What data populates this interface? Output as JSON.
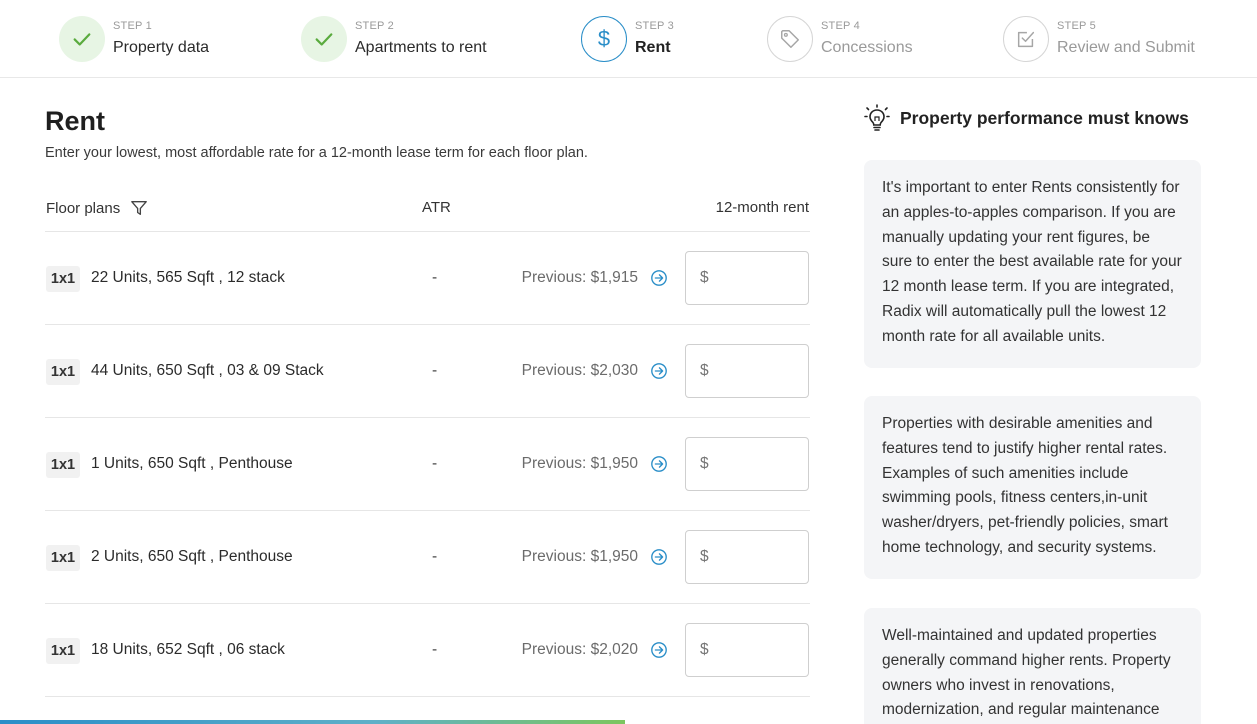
{
  "stepper": {
    "steps": [
      {
        "num": "STEP 1",
        "label": "Property data",
        "state": "done"
      },
      {
        "num": "STEP 2",
        "label": "Apartments to rent",
        "state": "done"
      },
      {
        "num": "STEP 3",
        "label": "Rent",
        "state": "active"
      },
      {
        "num": "STEP 4",
        "label": "Concessions",
        "state": "todo"
      },
      {
        "num": "STEP 5",
        "label": "Review and Submit",
        "state": "todo"
      }
    ]
  },
  "main": {
    "title": "Rent",
    "subtitle": "Enter your lowest, most affordable rate for a 12-month lease term for each floor plan.",
    "table": {
      "headers": {
        "floor_plans": "Floor plans",
        "atr": "ATR",
        "rent": "12-month rent"
      },
      "rows": [
        {
          "type": "1x1",
          "desc": "22 Units, 565 Sqft , 12 stack",
          "atr": "-",
          "previous": "Previous: $1,915",
          "input_placeholder": "$"
        },
        {
          "type": "1x1",
          "desc": "44 Units, 650 Sqft , 03 & 09 Stack",
          "atr": "-",
          "previous": "Previous: $2,030",
          "input_placeholder": "$"
        },
        {
          "type": "1x1",
          "desc": "1 Units, 650 Sqft , Penthouse",
          "atr": "-",
          "previous": "Previous: $1,950",
          "input_placeholder": "$"
        },
        {
          "type": "1x1",
          "desc": "2 Units, 650 Sqft , Penthouse",
          "atr": "-",
          "previous": "Previous: $1,950",
          "input_placeholder": "$"
        },
        {
          "type": "1x1",
          "desc": "18 Units, 652 Sqft , 06 stack",
          "atr": "-",
          "previous": "Previous: $2,020",
          "input_placeholder": "$"
        }
      ]
    }
  },
  "tips": {
    "title": "Property performance must knows",
    "cards": [
      "It's important to enter Rents consistently for an apples-to-apples comparison. If you are manually updating your rent figures, be sure to enter the best available rate for your 12 month lease term. If you are integrated, Radix will automatically pull the lowest 12 month rate for all available units.",
      "Properties with desirable amenities and features tend to justify higher rental rates. Examples of such amenities include swimming pools, fitness centers,in-unit washer/dryers, pet-friendly policies, smart home technology, and security systems.",
      "Well-maintained and updated properties generally command higher rents. Property owners who invest in renovations, modernization, and regular maintenance"
    ]
  },
  "colors": {
    "accent": "#2a8ec8",
    "done": "#5aab3e",
    "done_bg": "#e7f5e4",
    "muted": "#9a9a9a"
  }
}
